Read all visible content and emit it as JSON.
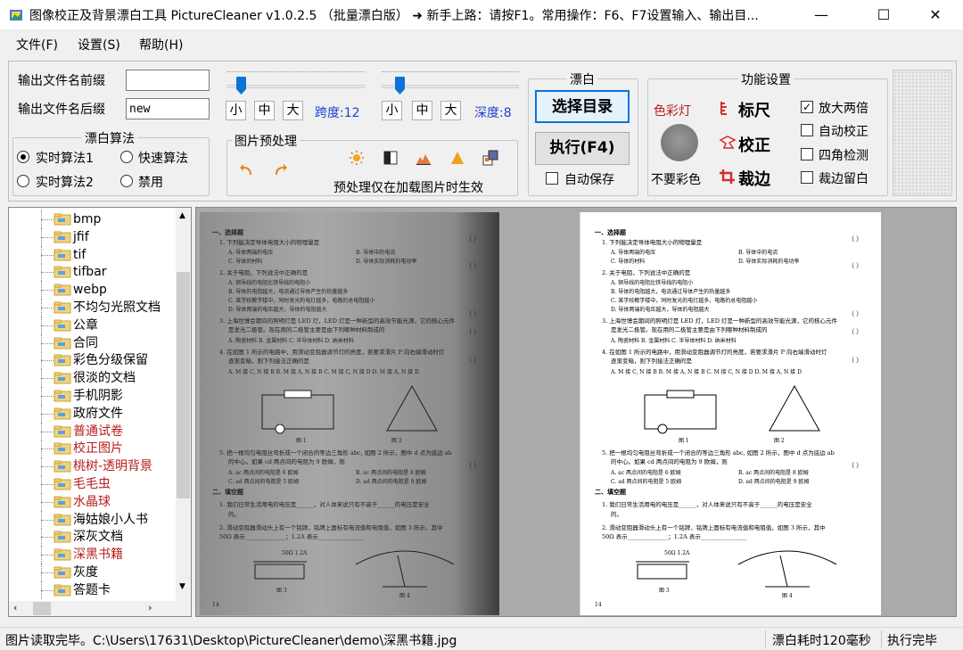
{
  "window": {
    "title": "图像校正及背景漂白工具 PictureCleaner v1.0.2.5 （批量漂白版） ➜ 新手上路：请按F1。常用操作：F6、F7设置输入、输出目...",
    "minimize": "—",
    "maximize": "☐",
    "close": "✕"
  },
  "menu": {
    "file": "文件(F)",
    "settings": "设置(S)",
    "help": "帮助(H)"
  },
  "output": {
    "prefix_label": "输出文件名前缀",
    "prefix_value": "",
    "suffix_label": "输出文件名后缀",
    "suffix_value": "new"
  },
  "algorithm": {
    "legend": "漂白算法",
    "options": [
      "实时算法1",
      "快速算法",
      "实时算法2",
      "禁用"
    ],
    "selected": "实时算法1"
  },
  "span": {
    "small": "小",
    "medium": "中",
    "large": "大",
    "label": "跨度:12",
    "value": 12
  },
  "depth": {
    "small": "小",
    "medium": "中",
    "large": "大",
    "label": "深度:8",
    "value": 8
  },
  "preprocess": {
    "legend": "图片预处理",
    "note": "预处理仅在加载图片时生效"
  },
  "bleach": {
    "legend": "漂白",
    "choose_dir": "选择目录",
    "execute": "执行(F4)",
    "auto_save": "自动保存",
    "auto_save_checked": false
  },
  "features": {
    "legend": "功能设置",
    "color_light": "色彩灯",
    "no_color": "不要彩色",
    "ruler": "标尺",
    "correct": "校正",
    "crop": "裁边",
    "zoom2x": "放大两倍",
    "zoom2x_checked": true,
    "auto_correct": "自动校正",
    "auto_correct_checked": false,
    "corner_detect": "四角检测",
    "corner_detect_checked": false,
    "crop_margin": "裁边留白",
    "crop_margin_checked": false
  },
  "tree": {
    "items": [
      {
        "label": "bmp",
        "color": "#000"
      },
      {
        "label": "jfif",
        "color": "#000"
      },
      {
        "label": "tif",
        "color": "#000"
      },
      {
        "label": "tifbar",
        "color": "#000"
      },
      {
        "label": "webp",
        "color": "#000"
      },
      {
        "label": "不均匀光照文档",
        "color": "#000"
      },
      {
        "label": "公章",
        "color": "#000"
      },
      {
        "label": "合同",
        "color": "#000"
      },
      {
        "label": "彩色分级保留",
        "color": "#000"
      },
      {
        "label": "很淡的文档",
        "color": "#000"
      },
      {
        "label": "手机阴影",
        "color": "#000"
      },
      {
        "label": "政府文件",
        "color": "#000"
      },
      {
        "label": "普通试卷",
        "color": "#b71c1c"
      },
      {
        "label": "校正图片",
        "color": "#b71c1c"
      },
      {
        "label": "桃树-透明背景",
        "color": "#b71c1c"
      },
      {
        "label": "毛毛虫",
        "color": "#b71c1c"
      },
      {
        "label": "水晶球",
        "color": "#b71c1c"
      },
      {
        "label": "海姑娘小人书",
        "color": "#000"
      },
      {
        "label": "深灰文档",
        "color": "#000"
      },
      {
        "label": "深黑书籍",
        "color": "#b71c1c"
      },
      {
        "label": "灰度",
        "color": "#000"
      },
      {
        "label": "答题卡",
        "color": "#000"
      }
    ]
  },
  "document": {
    "section1": "一、选择题",
    "q1": "1. 下列能决定导体电阻大小的物理量是",
    "q1a": "A. 导体两端的电压",
    "q1b": "B. 导体中的电流",
    "q1c": "C. 导体的材料",
    "q1d": "D. 导体实际消耗的电功率",
    "q2": "2. 关于电阻，下列说法中正确的是",
    "q2a": "A. 铜导线的电阻比铁导线的电阻小",
    "q2b": "B. 导体的电阻越大，电流通过导体产生的热量越多",
    "q2c": "C. 某学校教学楼中，同时发光的电灯越多，电路的总电阻越小",
    "q2d": "D. 导体两端的电压越大，导体的电阻越大",
    "q3": "3. 上海世博会期间的照明灯是 LED 灯，LED 灯是一种新型的高效节能光源，它的核心元件",
    "q3b": "是发光二极管。现在用的二极管主要是由下列哪种材料制成的",
    "q3opts": "A. 陶瓷材料    B. 金属材料    C. 半导体材料    D. 纳米材料",
    "q4": "4. 在如图 1 所示的电路中，用滑动变阻器调节灯的亮度，若要求滑片 P 向右端滑动时灯",
    "q4b": "逐渐变暗，则下列接法正确的是",
    "q4opts": "A. M 接 C, N 接 B    B. M 接 A, N 接 B    C. M 接 C, N 接 D    D. M 接 A, N 接 D",
    "fig1": "图 1",
    "fig2": "图 2",
    "q5": "5. 把一根均匀电阻丝弯折成一个闭合的等边三角形 abc, 如图 2 所示，图中 d 点为底边 ab",
    "q5b": "的中心。如果 cd 两点间的电阻为 9 欧姆，则",
    "q5a": "A. ac 两点间的电阻是 6 欧姆",
    "q5bb": "B. ac 两点间的电阻是 8 欧姆",
    "q5c": "C. ad 两点间的电阻是 5 欧姆",
    "q5d": "D. ad 两点间的电阻是 9 欧姆",
    "section2": "二、填空题",
    "f1": "1. 我们日常生活用电的电压是______，对人体来说只有不高于______的电压是安全",
    "f1b": "的。",
    "f2": "2. 滑动变阻器滑动头上有一个铭牌，铭牌上面标有电流值和电阻值，如图 3 所示，其中",
    "f2b": "50Ω 表示______________；1.2A 表示________________",
    "rheo": "50Ω 1.2A",
    "fig3": "图 3",
    "fig4": "图 4",
    "page": "14",
    "paren": "（  ）"
  },
  "status": {
    "message": "图片读取完毕。C:\\Users\\17631\\Desktop\\PictureCleaner\\demo\\深黑书籍.jpg",
    "time": "漂白耗时120毫秒",
    "state": "执行完毕"
  }
}
